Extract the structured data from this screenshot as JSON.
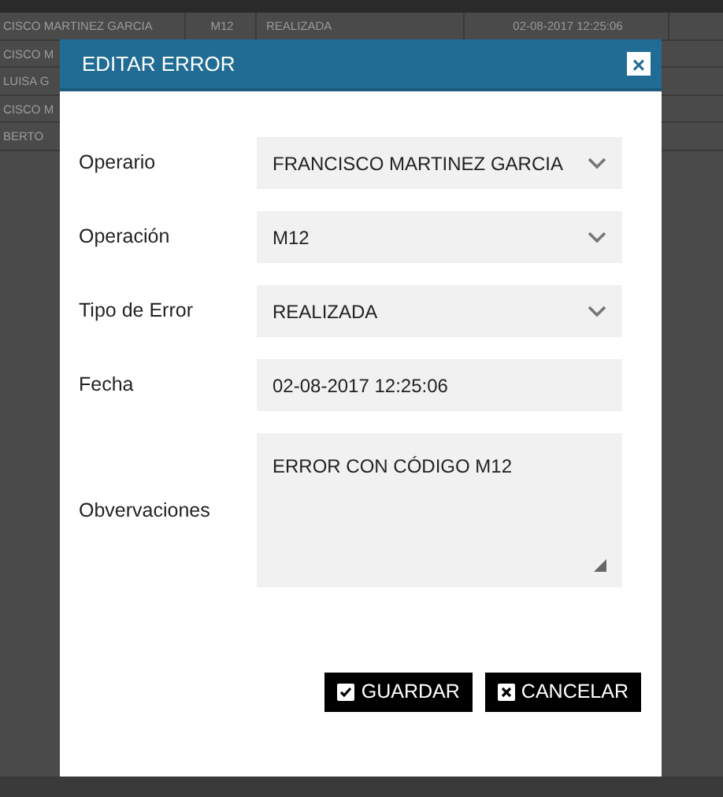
{
  "background_table": {
    "rows": [
      {
        "cells": [
          "CISCO MARTINEZ GARCIA",
          "M12",
          "REALIZADA",
          "02-08-2017 12:25:06"
        ]
      },
      {
        "cells": [
          "CISCO M"
        ]
      },
      {
        "cells": [
          "LUISA G"
        ]
      },
      {
        "cells": [
          "CISCO M"
        ]
      },
      {
        "cells": [
          "BERTO"
        ]
      }
    ]
  },
  "modal": {
    "title": "EDITAR ERROR",
    "close": "×",
    "fields": [
      {
        "kind": "select",
        "label": "Operario",
        "value": "FRANCISCO MARTINEZ GARCIA"
      },
      {
        "kind": "select",
        "label": "Operación",
        "value": "M12"
      },
      {
        "kind": "select",
        "label": "Tipo de Error",
        "value": "REALIZADA"
      },
      {
        "kind": "text",
        "label": "Fecha",
        "value": "02-08-2017 12:25:06"
      },
      {
        "kind": "textarea",
        "label": "Obvervaciones",
        "value": "ERROR CON CÓDIGO M12"
      }
    ],
    "buttons": [
      {
        "kind": "save",
        "label": "GUARDAR"
      },
      {
        "kind": "cancel",
        "label": "CANCELAR"
      }
    ]
  }
}
